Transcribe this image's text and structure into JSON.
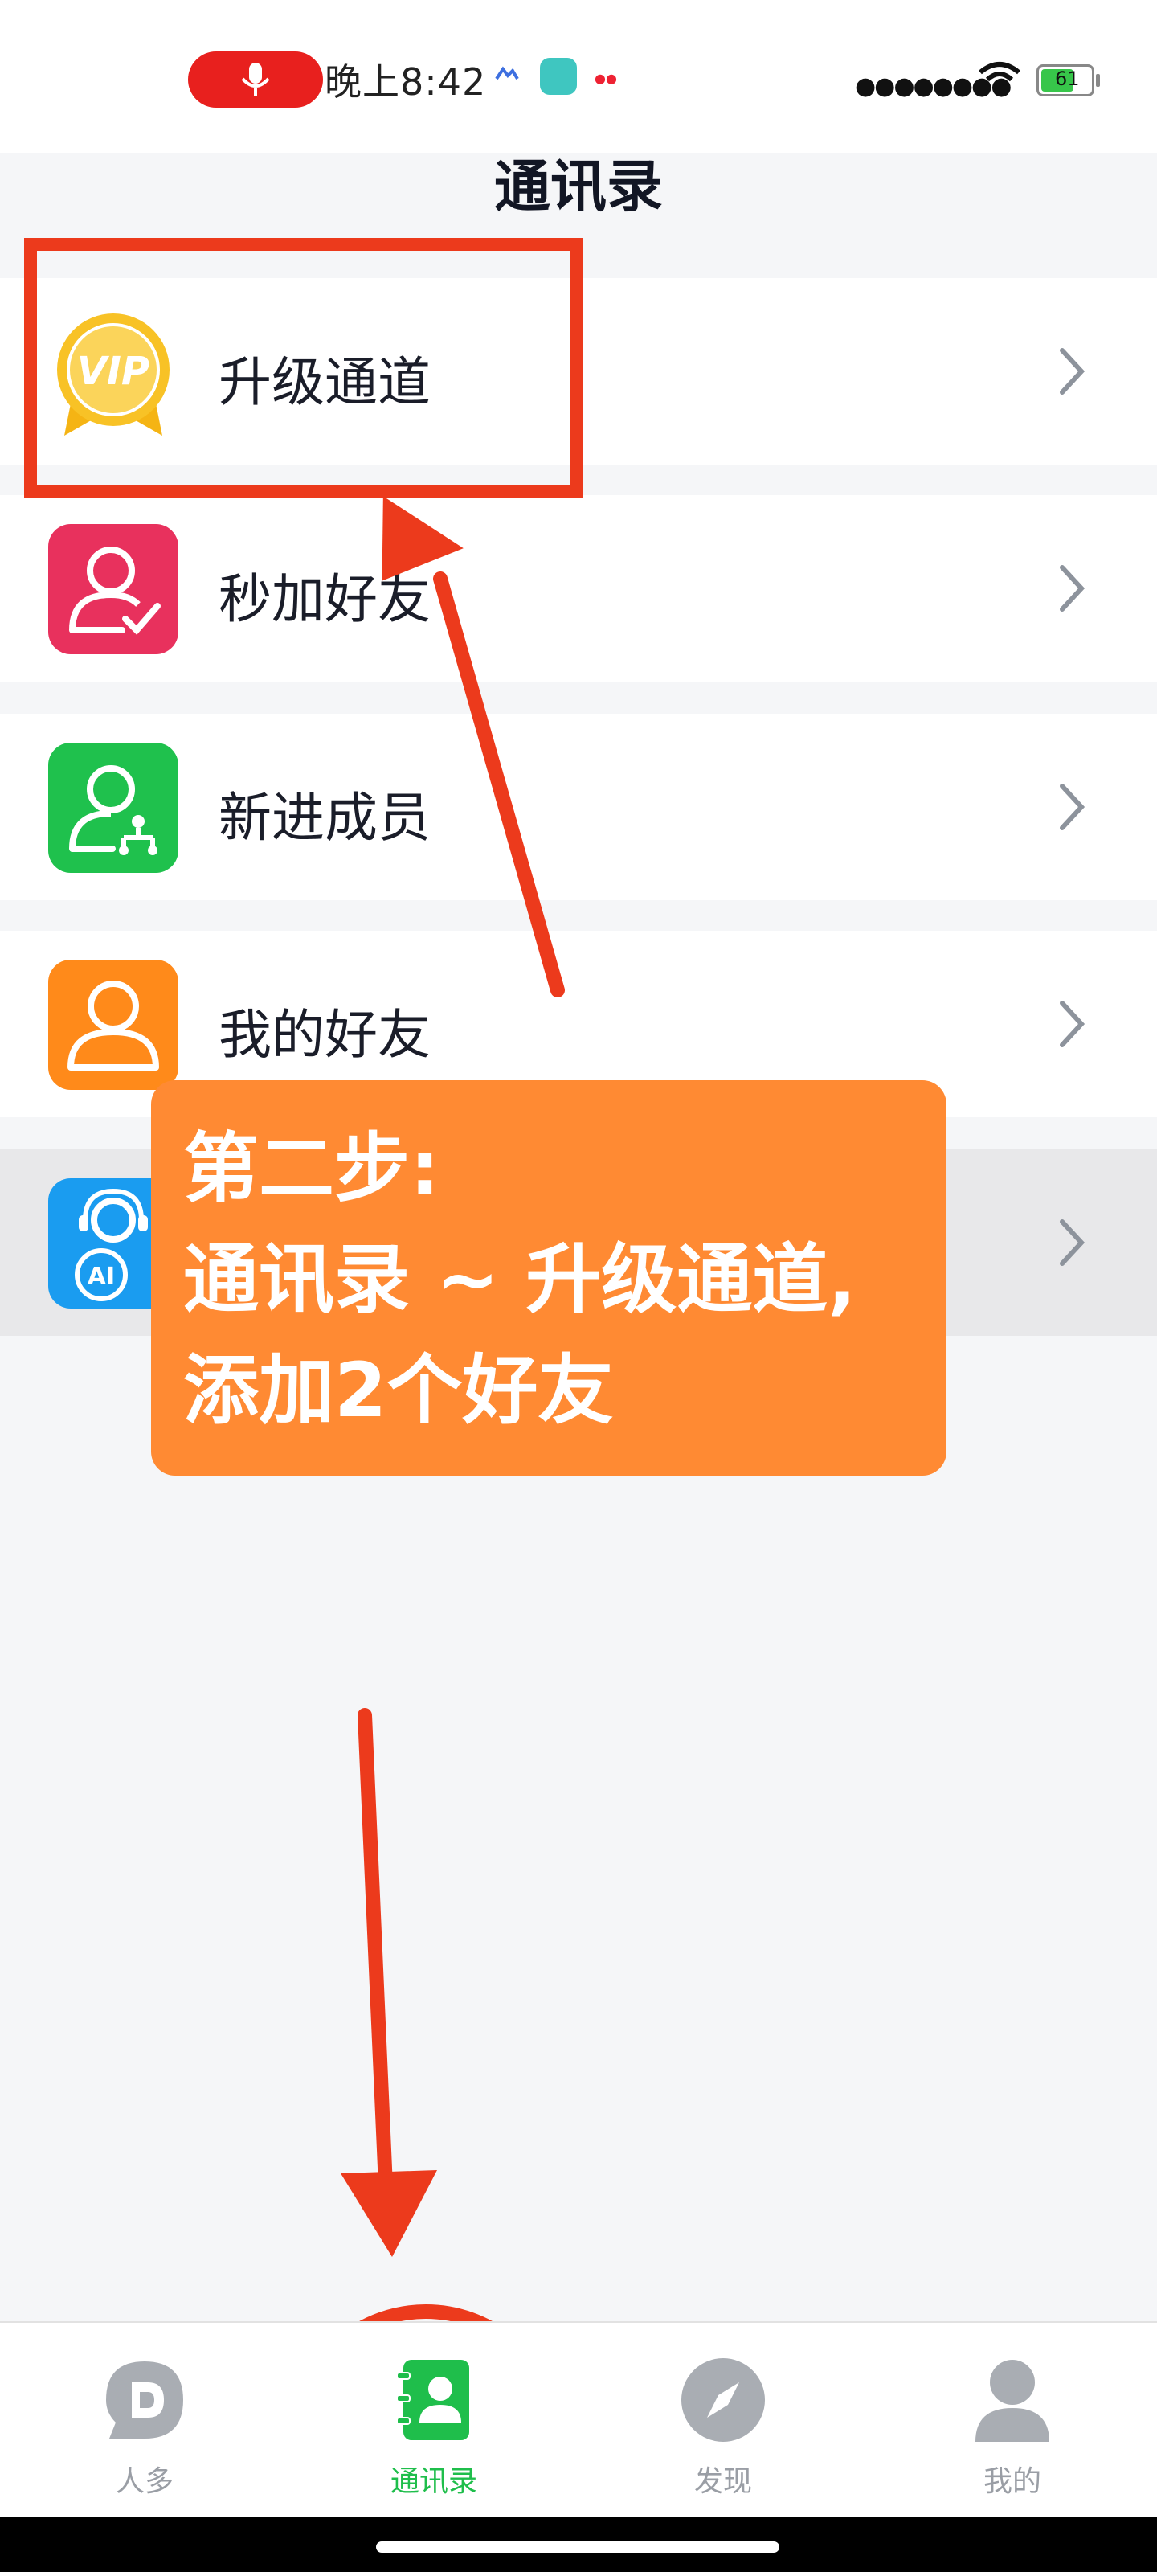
{
  "status": {
    "time": "晚上8:42",
    "battery": "61"
  },
  "header": {
    "title": "通讯录"
  },
  "list": [
    {
      "label": "升级通道",
      "icon": "vip-badge-icon"
    },
    {
      "label": "秒加好友",
      "icon": "add-friend-check-icon"
    },
    {
      "label": "新进成员",
      "icon": "new-member-network-icon"
    },
    {
      "label": "我的好友",
      "icon": "my-friends-person-icon"
    },
    {
      "label": "",
      "icon": "ai-assistant-icon"
    }
  ],
  "annotation": {
    "line1": "第二步:",
    "line2": "通讯录 ~ 升级通道,",
    "line3": "添加2个好友"
  },
  "tabs": [
    {
      "label": "人多",
      "icon": "chat-logo-icon"
    },
    {
      "label": "通讯录",
      "icon": "contacts-book-icon",
      "active": true
    },
    {
      "label": "发现",
      "icon": "compass-icon"
    },
    {
      "label": "我的",
      "icon": "profile-icon"
    }
  ],
  "colors": {
    "accent_green": "#1fbe4b",
    "annotation_red": "#ec3a1c",
    "callout_orange": "#ff8a33"
  }
}
